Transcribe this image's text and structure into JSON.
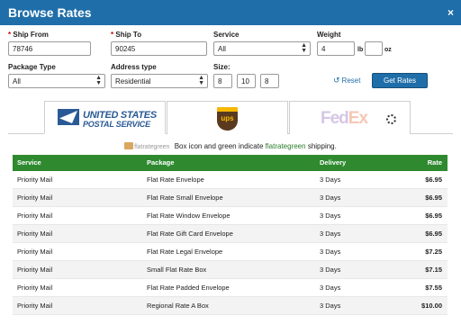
{
  "window": {
    "title": "Browse Rates",
    "close_glyph": "×"
  },
  "form": {
    "ship_from": {
      "label": "Ship From",
      "value": "78746"
    },
    "ship_to": {
      "label": "Ship To",
      "value": "90245"
    },
    "service": {
      "label": "Service",
      "value": "All"
    },
    "weight": {
      "label": "Weight",
      "lb_value": "4",
      "lb_unit": "lb",
      "oz_value": "",
      "oz_unit": "oz"
    },
    "package_type": {
      "label": "Package Type",
      "value": "All"
    },
    "address_type": {
      "label": "Address type",
      "value": "Residential"
    },
    "size": {
      "label": "Size:",
      "l": "8",
      "w": "10",
      "h": "8"
    },
    "reset_label": "Reset",
    "get_rates_label": "Get Rates"
  },
  "carriers": [
    {
      "name": "USPS",
      "line1": "UNITED STATES",
      "line2": "POSTAL SERVICE",
      "active": true
    },
    {
      "name": "UPS",
      "mark": "ups",
      "active": false
    },
    {
      "name": "FedEx",
      "fed": "Fed",
      "ex": "Ex",
      "active": false
    }
  ],
  "legend": {
    "box_label": "flatrategreen",
    "text_before": "Box icon and green indicate",
    "green_word": "flatrategreen",
    "text_after": "shipping."
  },
  "table": {
    "headers": {
      "service": "Service",
      "package": "Package",
      "delivery": "Delivery",
      "rate": "Rate"
    },
    "rows": [
      {
        "service": "Priority Mail",
        "package": "Flat Rate Envelope",
        "delivery": "3 Days",
        "rate": "$6.95"
      },
      {
        "service": "Priority Mail",
        "package": "Flat Rate Small Envelope",
        "delivery": "3 Days",
        "rate": "$6.95"
      },
      {
        "service": "Priority Mail",
        "package": "Flat Rate Window Envelope",
        "delivery": "3 Days",
        "rate": "$6.95"
      },
      {
        "service": "Priority Mail",
        "package": "Flat Rate Gift Card Envelope",
        "delivery": "3 Days",
        "rate": "$6.95"
      },
      {
        "service": "Priority Mail",
        "package": "Flat Rate Legal Envelope",
        "delivery": "3 Days",
        "rate": "$7.25"
      },
      {
        "service": "Priority Mail",
        "package": "Small Flat Rate Box",
        "delivery": "3 Days",
        "rate": "$7.15"
      },
      {
        "service": "Priority Mail",
        "package": "Flat Rate Padded Envelope",
        "delivery": "3 Days",
        "rate": "$7.55"
      },
      {
        "service": "Priority Mail",
        "package": "Regional Rate A Box",
        "delivery": "3 Days",
        "rate": "$10.00"
      }
    ]
  }
}
